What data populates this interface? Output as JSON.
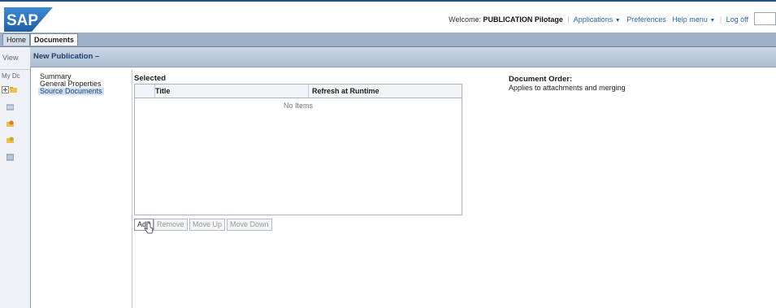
{
  "header": {
    "logo_text": "SAP",
    "welcome_prefix": "Welcome:",
    "user_name": "PUBLICATION Pilotage",
    "links": [
      "Applications",
      "Preferences",
      "Help menu",
      "Log off"
    ]
  },
  "tabs": [
    "Home",
    "Documents"
  ],
  "left_panel": {
    "view_label": "View",
    "my_docs_label": "My Dc"
  },
  "dialog": {
    "title": "New Publication –",
    "nav": [
      "Summary",
      "General Properties",
      "Source Documents"
    ],
    "selected_label": "Selected",
    "columns": [
      "Title",
      "Refresh at Runtime"
    ],
    "empty_text": "No Items",
    "buttons": [
      "Add",
      "Remove",
      "Move Up",
      "Move Down"
    ],
    "document_order_title": "Document Order:",
    "document_order_desc": "Applies to attachments and merging"
  },
  "colors": {
    "accent": "#1f4e8c",
    "tabstrip": "#9fb1c6",
    "titlebar": "#aebfd3"
  }
}
